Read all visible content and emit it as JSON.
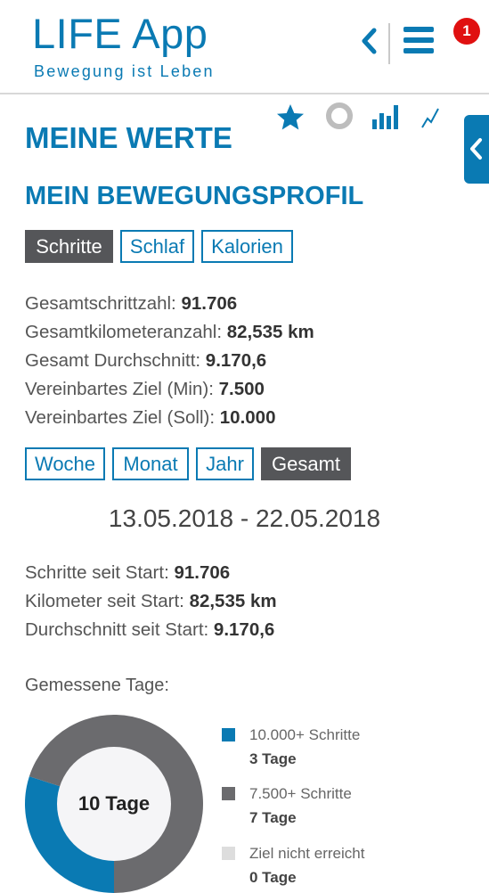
{
  "header": {
    "app_name": "LIFE App",
    "tagline": "Bewegung ist Leben",
    "notification_count": "1"
  },
  "toolbar_icons": [
    "star-icon",
    "ring-icon",
    "bar-chart-icon",
    "line-chart-icon"
  ],
  "page_title": "MEINE WERTE",
  "section_title": "MEIN BEWEGUNGSPROFIL",
  "category_tabs": [
    {
      "label": "Schritte",
      "active": true
    },
    {
      "label": "Schlaf",
      "active": false
    },
    {
      "label": "Kalorien",
      "active": false
    }
  ],
  "stats": [
    {
      "label": "Gesamtschrittzahl: ",
      "value": "91.706"
    },
    {
      "label": "Gesamtkilometeranzahl: ",
      "value": "82,535 km"
    },
    {
      "label": "Gesamt Durchschnitt: ",
      "value": "9.170,6"
    },
    {
      "label": "Vereinbartes Ziel (Min): ",
      "value": "7.500"
    },
    {
      "label": "Vereinbartes Ziel (Soll): ",
      "value": "10.000"
    }
  ],
  "period_tabs": [
    {
      "label": "Woche",
      "active": false
    },
    {
      "label": "Monat",
      "active": false
    },
    {
      "label": "Jahr",
      "active": false
    },
    {
      "label": "Gesamt",
      "active": true
    }
  ],
  "date_range": "13.05.2018 - 22.05.2018",
  "since_start": [
    {
      "label": "Schritte seit Start: ",
      "value": "91.706"
    },
    {
      "label": "Kilometer seit Start: ",
      "value": "82,535 km"
    },
    {
      "label": "Durchschnitt seit Start: ",
      "value": "9.170,6"
    }
  ],
  "measured_days_label": "Gemessene Tage:",
  "donut_center": "10 Tage",
  "chart_data": {
    "type": "pie",
    "categories": [
      "10.000+ Schritte",
      "7.500+ Schritte",
      "Ziel nicht erreicht"
    ],
    "values": [
      3,
      7,
      0
    ],
    "colors": [
      "#0a7ab3",
      "#6b6b6e",
      "#dddddd"
    ],
    "value_labels": [
      "3 Tage",
      "7 Tage",
      "0 Tage"
    ]
  },
  "colors": {
    "accent": "#0a7ab3",
    "active_tab": "#555659",
    "notification": "#e01010"
  }
}
